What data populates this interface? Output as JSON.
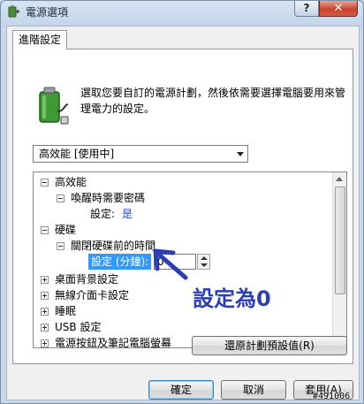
{
  "window": {
    "title": "電源選項",
    "help_label": "?",
    "close_label": "✕"
  },
  "tabs": [
    {
      "label": "進階設定"
    }
  ],
  "description": "選取您要自訂的電源計劃，然後依需要選擇電腦要用來管理電力的設定。",
  "plan_dropdown": {
    "selected": "高效能 [使用中]"
  },
  "tree": {
    "high_perf": "高效能",
    "wake_password": "喚醒時需要密碼",
    "wake_setting_label": "設定:",
    "wake_setting_value": "是",
    "hard_disk": "硬碟",
    "turn_off_disk": "關閉硬碟前的時間",
    "disk_setting_label": "設定 (分鐘):",
    "disk_setting_value": "0",
    "desktop_bg": "桌面背景設定",
    "wireless": "無線介面卡設定",
    "sleep": "睡眠",
    "usb": "USB 設定",
    "power_buttons": "電源按鈕及筆記電腦螢幕"
  },
  "annotation": {
    "text": "設定為0",
    "color": "#2b3fb3"
  },
  "buttons": {
    "restore_defaults": "還原計劃預設值(R)",
    "ok": "確定",
    "cancel": "取消",
    "apply": "套用(A)"
  },
  "watermark": "#491006",
  "icons": {
    "title": "power-options-icon",
    "battery": "battery-plug-icon"
  }
}
